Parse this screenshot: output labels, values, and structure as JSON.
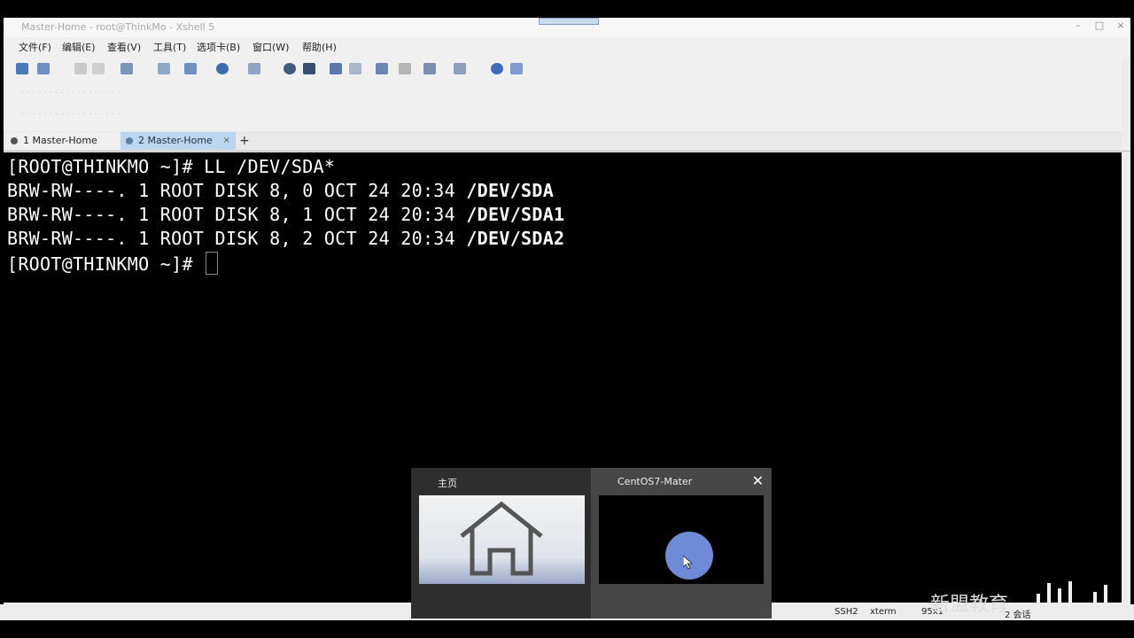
{
  "window": {
    "title": "Master-Home - root@ThinkMo - Xshell 5"
  },
  "menu": [
    "文件(F)",
    "编辑(E)",
    "查看(V)",
    "工具(T)",
    "选项卡(B)",
    "窗口(W)",
    "帮助(H)"
  ],
  "tabs": [
    {
      "label": "1 Master-Home",
      "active": false
    },
    {
      "label": "2 Master-Home",
      "active": true,
      "close": "×"
    }
  ],
  "add_tab": "+",
  "terminal": {
    "lines": [
      {
        "text": "[ROOT@THINKMO ~]# LL /DEV/SDA*"
      },
      {
        "prefix": "BRW-RW----. 1 ROOT DISK 8, 0 OCT 24 20:34 ",
        "path": "/DEV/SDA"
      },
      {
        "prefix": "BRW-RW----. 1 ROOT DISK 8, 1 OCT 24 20:34 ",
        "path": "/DEV/SDA1"
      },
      {
        "prefix": "BRW-RW----. 1 ROOT DISK 8, 2 OCT 24 20:34 ",
        "path": "/DEV/SDA2"
      },
      {
        "text": "[ROOT@THINKMO ~]# "
      }
    ]
  },
  "taskbar_popup": {
    "home_title": "主页",
    "app_title": "CentOS7-Mater",
    "close": "✕"
  },
  "statusbar": {
    "protocol": "SSH2",
    "terminal_type": "xterm",
    "size": "95x1",
    "sessions": "2 会话"
  },
  "watermark": "新盟教育",
  "colors": {
    "terminal_bg": "#000000",
    "terminal_fg": "#ffffff",
    "active_tab": "#bcd6f0"
  }
}
